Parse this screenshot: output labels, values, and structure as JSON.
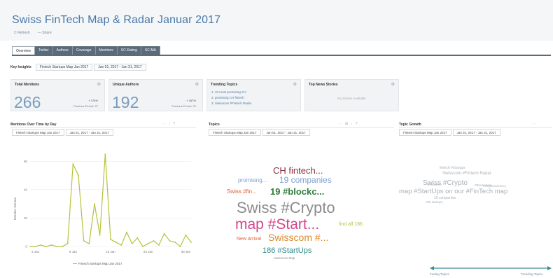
{
  "header": {
    "title": "Swiss FinTech Map & Radar Januar 2017",
    "refresh_label": "C Refresh",
    "share_label": "— Share"
  },
  "tabs": [
    {
      "label": "Overview",
      "active": true
    },
    {
      "label": "Twitter"
    },
    {
      "label": "Authors"
    },
    {
      "label": "Coverage"
    },
    {
      "label": "Mentions"
    },
    {
      "label": "SC-Rating"
    },
    {
      "label": "SC-MA"
    }
  ],
  "filters": {
    "label": "Key Insights",
    "collection": "Fintech Startups Map Jan 2017",
    "date_range": "Jan 01, 2017 - Jan 31, 2017"
  },
  "cards": {
    "total_mentions": {
      "title": "Total Mentions",
      "value": "266",
      "change": "+ 174%",
      "previous": "Previous Period: 97"
    },
    "unique_authors": {
      "title": "Unique Authors",
      "value": "192",
      "change": "+ 167%",
      "previous": "Previous Period: 72"
    },
    "trending_topics": {
      "title": "Trending Topics",
      "items": [
        "1.  10 most promising CH",
        "2.  promising CH fintech",
        "3.  Swisscom #Fintech Radar"
      ]
    },
    "top_news": {
      "title": "Top News Stories",
      "empty_text": "No Stories Available"
    }
  },
  "mentions_chart": {
    "title": "Mentions Over Time by Day",
    "collection": "Fintech Startups Map Jan 2017",
    "date_range": "Jan 01, 2017 - Jan 31, 2017"
  },
  "topics_panel": {
    "title": "Topics",
    "collection": "Fintech Startups Map Jan 2017",
    "date_range": "Jan 01, 2017 - Jan 31, 2017",
    "words": [
      {
        "text": "CH fintech...",
        "color": "#8b2e3c"
      },
      {
        "text": "promising...",
        "color": "#7b9fd4"
      },
      {
        "text": "19 companies",
        "color": "#7b9fd4"
      },
      {
        "text": "Swiss #fin...",
        "color": "#e0603a"
      },
      {
        "text": "19 #blockc...",
        "color": "#2e7d3a"
      },
      {
        "text": "Swiss #Crypto",
        "color": "#8c8c8c"
      },
      {
        "text": "map #Start...",
        "color": "#d4458c"
      },
      {
        "text": "find all 186",
        "color": "#b8c23a"
      },
      {
        "text": "New arrival",
        "color": "#e0603a"
      },
      {
        "text": "Swisscom #...",
        "color": "#d98a2c"
      },
      {
        "text": "186 #StartUps",
        "color": "#2c8a8a"
      },
      {
        "text": "Swisscom Map",
        "color": "#888888"
      }
    ]
  },
  "growth_panel": {
    "title": "Topic Growth",
    "collection": "Fintech Startups Map Jan 2017",
    "date_range": "Jan 01, 2017 - Jan 31, 2017",
    "words": [
      {
        "text": "fintech #startups"
      },
      {
        "text": "Swisscom #Fintech Radar"
      },
      {
        "text": "Swiss #Crypto"
      },
      {
        "text": "#Blockchain"
      },
      {
        "text": "map #StartUps on our #FinTech map"
      },
      {
        "text": "#Cryptocurrency"
      },
      {
        "text": "#Insurtech"
      },
      {
        "text": "19 companies"
      },
      {
        "text": "186 startups"
      }
    ],
    "fading_label": "Fading Topics",
    "trending_label": "Trending Topics"
  },
  "chart_data": {
    "type": "line",
    "title": "Mentions Over Time by Day",
    "xlabel": "",
    "ylabel": "Mention Volume",
    "x": [
      "1 Jan",
      "2 Jan",
      "3 Jan",
      "4 Jan",
      "5 Jan",
      "6 Jan",
      "7 Jan",
      "8 Jan",
      "9 Jan",
      "10 Jan",
      "11 Jan",
      "12 Jan",
      "13 Jan",
      "14 Jan",
      "15 Jan",
      "16 Jan",
      "17 Jan",
      "18 Jan",
      "19 Jan",
      "20 Jan",
      "21 Jan",
      "22 Jan",
      "23 Jan",
      "24 Jan",
      "25 Jan",
      "26 Jan",
      "27 Jan",
      "28 Jan",
      "29 Jan",
      "30 Jan",
      "31 Jan"
    ],
    "x_ticks": [
      "2 Jan",
      "9 Jan",
      "16 Jan",
      "23 Jan",
      "30 Jan"
    ],
    "y_ticks": [
      0,
      20,
      40,
      60
    ],
    "ylim": [
      0,
      70
    ],
    "grid": true,
    "series": [
      {
        "name": "Fintech Startups Map Jan 2017",
        "color": "#b8c23a",
        "values": [
          0,
          0,
          1,
          0,
          1,
          0,
          0,
          2,
          58,
          50,
          4,
          2,
          30,
          8,
          65,
          5,
          3,
          1,
          10,
          2,
          6,
          0,
          2,
          4,
          1,
          9,
          4,
          3,
          0,
          8,
          3
        ]
      }
    ]
  }
}
